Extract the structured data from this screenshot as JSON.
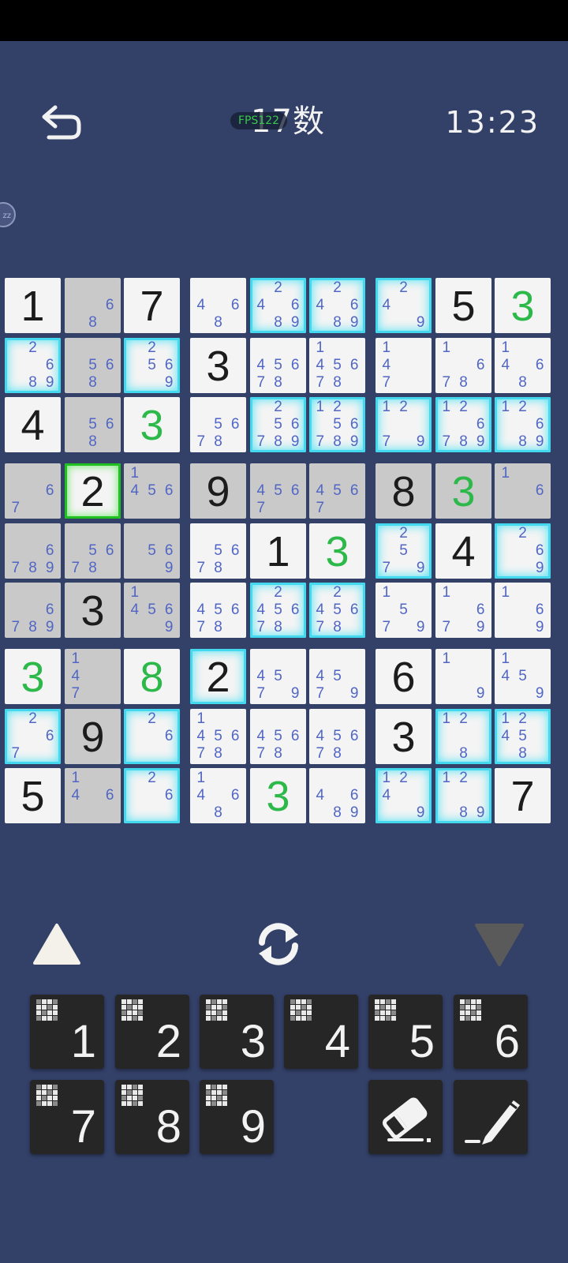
{
  "header": {
    "title": "17数",
    "fps": "FPS122",
    "timer": "13:23",
    "sleep_badge": "zz"
  },
  "colors": {
    "background": "#334068",
    "highlight": "#44d8ee",
    "selected": "#20c020",
    "placed_digit": "#2db84a",
    "note_digit": "#5166c4"
  },
  "board": {
    "rows": [
      [
        {
          "v": "1",
          "t": "given",
          "bg": "white"
        },
        {
          "n": [
            6,
            8
          ],
          "bg": "gray"
        },
        {
          "v": "7",
          "t": "given",
          "bg": "white"
        },
        {
          "n": [
            4,
            6,
            8
          ],
          "bg": "white"
        },
        {
          "n": [
            2,
            4,
            6,
            8,
            9
          ],
          "bg": "white",
          "hl": true
        },
        {
          "n": [
            2,
            4,
            6,
            8,
            9
          ],
          "bg": "white",
          "hl": true
        },
        {
          "n": [
            2,
            4,
            9
          ],
          "bg": "white",
          "hl": true
        },
        {
          "v": "5",
          "t": "given",
          "bg": "white"
        },
        {
          "v": "3",
          "t": "green",
          "bg": "white"
        }
      ],
      [
        {
          "n": [
            2,
            6,
            8,
            9
          ],
          "bg": "white",
          "hl": true
        },
        {
          "n": [
            5,
            6,
            8
          ],
          "bg": "gray"
        },
        {
          "n": [
            2,
            5,
            6,
            9
          ],
          "bg": "white",
          "hl": true
        },
        {
          "v": "3",
          "t": "given",
          "bg": "white"
        },
        {
          "n": [
            4,
            5,
            6,
            7,
            8
          ],
          "bg": "white"
        },
        {
          "n": [
            1,
            4,
            5,
            6,
            7,
            8
          ],
          "bg": "white"
        },
        {
          "n": [
            1,
            4,
            7
          ],
          "bg": "white"
        },
        {
          "n": [
            1,
            6,
            7,
            8
          ],
          "bg": "white"
        },
        {
          "n": [
            1,
            4,
            6,
            8
          ],
          "bg": "white"
        }
      ],
      [
        {
          "v": "4",
          "t": "given",
          "bg": "white"
        },
        {
          "n": [
            5,
            6,
            8
          ],
          "bg": "gray"
        },
        {
          "v": "3",
          "t": "green",
          "bg": "white"
        },
        {
          "n": [
            5,
            6,
            7,
            8
          ],
          "bg": "white"
        },
        {
          "n": [
            2,
            5,
            6,
            7,
            8,
            9
          ],
          "bg": "white",
          "hl": true
        },
        {
          "n": [
            1,
            2,
            5,
            6,
            7,
            8,
            9
          ],
          "bg": "white",
          "hl": true
        },
        {
          "n": [
            1,
            2,
            7,
            9
          ],
          "bg": "white",
          "hl": true
        },
        {
          "n": [
            1,
            2,
            6,
            7,
            8,
            9
          ],
          "bg": "white",
          "hl": true
        },
        {
          "n": [
            1,
            2,
            6,
            8,
            9
          ],
          "bg": "white",
          "hl": true
        }
      ],
      [
        {
          "n": [
            6,
            7
          ],
          "bg": "gray"
        },
        {
          "v": "2",
          "t": "given",
          "bg": "white",
          "sel": true
        },
        {
          "n": [
            1,
            4,
            5,
            6
          ],
          "bg": "gray"
        },
        {
          "v": "9",
          "t": "given",
          "bg": "gray"
        },
        {
          "n": [
            4,
            5,
            6,
            7
          ],
          "bg": "gray"
        },
        {
          "n": [
            4,
            5,
            6,
            7
          ],
          "bg": "gray"
        },
        {
          "v": "8",
          "t": "given",
          "bg": "gray"
        },
        {
          "v": "3",
          "t": "green",
          "bg": "gray"
        },
        {
          "n": [
            1,
            6
          ],
          "bg": "gray"
        }
      ],
      [
        {
          "n": [
            6,
            7,
            8,
            9
          ],
          "bg": "gray"
        },
        {
          "n": [
            5,
            6,
            7,
            8
          ],
          "bg": "gray"
        },
        {
          "n": [
            5,
            6,
            9
          ],
          "bg": "gray"
        },
        {
          "n": [
            5,
            6,
            7,
            8
          ],
          "bg": "white"
        },
        {
          "v": "1",
          "t": "given",
          "bg": "white"
        },
        {
          "v": "3",
          "t": "green",
          "bg": "white"
        },
        {
          "n": [
            2,
            5,
            7,
            9
          ],
          "bg": "white",
          "hl": true
        },
        {
          "v": "4",
          "t": "given",
          "bg": "white"
        },
        {
          "n": [
            2,
            6,
            9
          ],
          "bg": "white",
          "hl": true
        }
      ],
      [
        {
          "n": [
            6,
            7,
            8,
            9
          ],
          "bg": "gray"
        },
        {
          "v": "3",
          "t": "given",
          "bg": "gray"
        },
        {
          "n": [
            1,
            4,
            5,
            6,
            9
          ],
          "bg": "gray"
        },
        {
          "n": [
            4,
            5,
            6,
            7,
            8
          ],
          "bg": "white"
        },
        {
          "n": [
            2,
            4,
            5,
            6,
            7,
            8
          ],
          "bg": "white",
          "hl": true
        },
        {
          "n": [
            2,
            4,
            5,
            6,
            7,
            8
          ],
          "bg": "white",
          "hl": true
        },
        {
          "n": [
            1,
            5,
            7,
            9
          ],
          "bg": "white"
        },
        {
          "n": [
            1,
            6,
            7,
            9
          ],
          "bg": "white"
        },
        {
          "n": [
            1,
            6,
            9
          ],
          "bg": "white"
        }
      ],
      [
        {
          "v": "3",
          "t": "green",
          "bg": "white"
        },
        {
          "n": [
            1,
            4,
            7
          ],
          "bg": "gray"
        },
        {
          "v": "8",
          "t": "green",
          "bg": "white"
        },
        {
          "v": "2",
          "t": "given",
          "bg": "white",
          "hl": true
        },
        {
          "n": [
            4,
            5,
            7,
            9
          ],
          "bg": "white"
        },
        {
          "n": [
            4,
            5,
            7,
            9
          ],
          "bg": "white"
        },
        {
          "v": "6",
          "t": "given",
          "bg": "white"
        },
        {
          "n": [
            1,
            9
          ],
          "bg": "white"
        },
        {
          "n": [
            1,
            4,
            5,
            9
          ],
          "bg": "white"
        }
      ],
      [
        {
          "n": [
            2,
            6,
            7
          ],
          "bg": "white",
          "hl": true
        },
        {
          "v": "9",
          "t": "given",
          "bg": "gray"
        },
        {
          "n": [
            2,
            6
          ],
          "bg": "white",
          "hl": true
        },
        {
          "n": [
            1,
            4,
            5,
            6,
            7,
            8
          ],
          "bg": "white"
        },
        {
          "n": [
            4,
            5,
            6,
            7,
            8
          ],
          "bg": "white"
        },
        {
          "n": [
            4,
            5,
            6,
            7,
            8
          ],
          "bg": "white"
        },
        {
          "v": "3",
          "t": "given",
          "bg": "white"
        },
        {
          "n": [
            1,
            2,
            8
          ],
          "bg": "white",
          "hl": true
        },
        {
          "n": [
            1,
            2,
            4,
            5,
            8
          ],
          "bg": "white",
          "hl": true
        }
      ],
      [
        {
          "v": "5",
          "t": "given",
          "bg": "white"
        },
        {
          "n": [
            1,
            4,
            6
          ],
          "bg": "gray"
        },
        {
          "n": [
            2,
            6
          ],
          "bg": "white",
          "hl": true
        },
        {
          "n": [
            1,
            4,
            6,
            8
          ],
          "bg": "white"
        },
        {
          "v": "3",
          "t": "green",
          "bg": "white"
        },
        {
          "n": [
            4,
            6,
            8,
            9
          ],
          "bg": "white"
        },
        {
          "n": [
            1,
            2,
            4,
            9
          ],
          "bg": "white",
          "hl": true
        },
        {
          "n": [
            1,
            2,
            8,
            9
          ],
          "bg": "white",
          "hl": true
        },
        {
          "v": "7",
          "t": "given",
          "bg": "white"
        }
      ]
    ]
  },
  "controls": {
    "up": "triangle-up-icon",
    "refresh": "refresh-icon",
    "down": "triangle-down-icon"
  },
  "keypad": {
    "digits": [
      "1",
      "2",
      "3",
      "4",
      "5",
      "6",
      "7",
      "8",
      "9"
    ],
    "eraser": "eraser-icon",
    "pencil": "pencil-icon"
  }
}
